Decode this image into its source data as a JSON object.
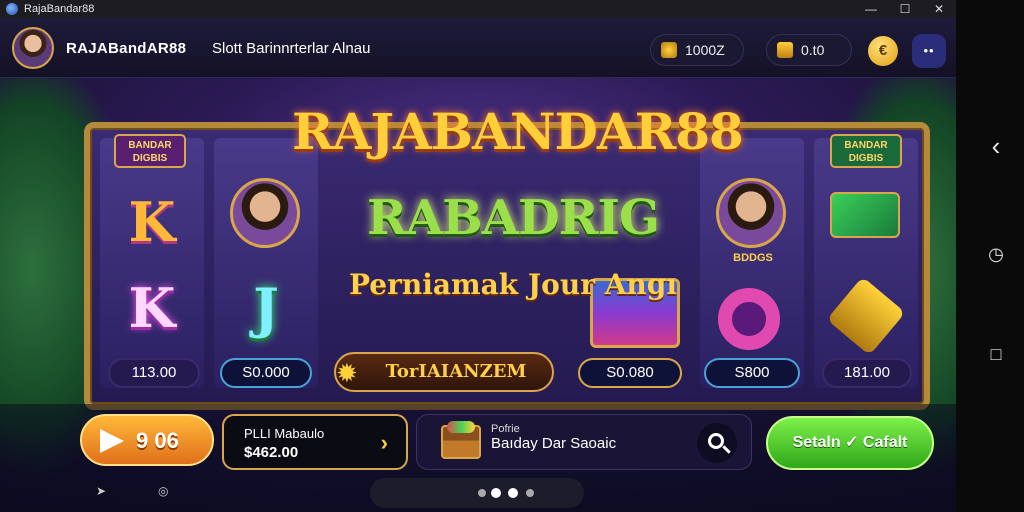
{
  "window": {
    "title": "RajaBandar88",
    "controls": {
      "minimize": "—",
      "maximize": "☐",
      "close": "✕"
    }
  },
  "header": {
    "brand": "RAJABandAR88",
    "subtitle": "Slott Barinnrterlar Alnau",
    "balance1": "1000Z",
    "balance2": "0.t0",
    "coin_icon": "€",
    "menu_icon": "••"
  },
  "game": {
    "title_line1": "RAJABANDAR88",
    "title_line2": "RABADRIG",
    "title_line3": "Perniamak Jour Angı",
    "center_banner": "TorIAIANZEM",
    "badge_left": "BANDAR\nDIGBIS",
    "badge_right": "BANDAR\nDIGBIS",
    "portrait_caption": "BDDGS",
    "reel_symbols": {
      "reel1_top": "K",
      "reel1_bottom": "K",
      "reel2_bottom": "J"
    },
    "reel_values": [
      "113.00",
      "S0.000",
      "S0.080",
      "S800",
      "181.00"
    ]
  },
  "bottom": {
    "play_value": "9 06",
    "info_line1": "PLLI Mabaulo",
    "info_line2": "$462.00",
    "info_chevron": "›",
    "search_line1": "Pofrie",
    "search_line2": "Baıday Dar Saoaic",
    "go_label": "Setaln ✓ Cafalt"
  },
  "side_nav": {
    "back": "‹",
    "recent": "◷",
    "home": "□"
  },
  "colors": {
    "accent_gold": "#d9a64a",
    "go_green": "#4ad02a",
    "play_orange": "#f09a2a"
  }
}
